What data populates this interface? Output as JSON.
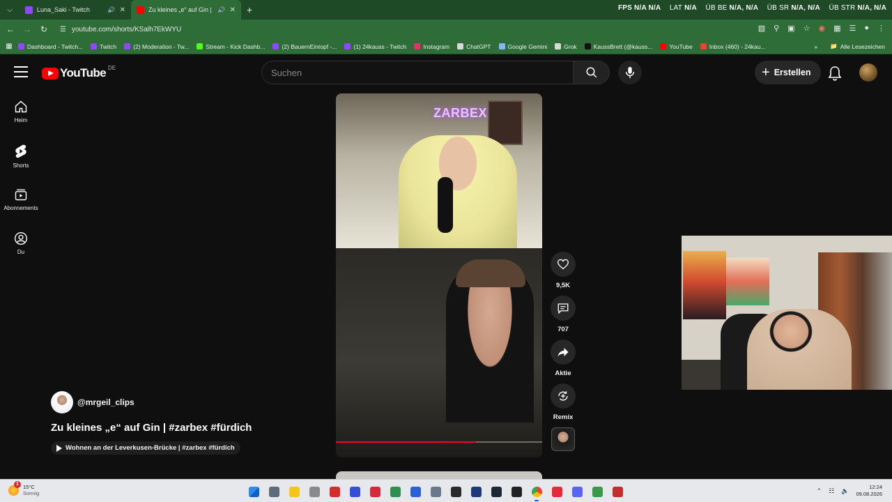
{
  "browser": {
    "tabs": [
      {
        "label": "Luna_Saki - Twitch",
        "color": "#9146ff",
        "active": false
      },
      {
        "label": "Zu kleines „e“ auf Gin | #zar",
        "color": "#ff0000",
        "active": true
      }
    ],
    "perf_overlay": {
      "fps_label": "FPS",
      "fps_value": "N/A N/A",
      "lat_label": "LAT",
      "lat_value": "N/A",
      "ube_label": "ÜB BE",
      "ube_value": "N/A, N/A",
      "usr_label": "ÜB SR",
      "usr_value": "N/A, N/A",
      "ustr_label": "ÜB STR",
      "ustr_value": "N/A, N/A"
    },
    "url": "youtube.com/shorts/KSalh7EkWYU",
    "bookmarks": [
      {
        "label": "Dashboard - Twitch...",
        "color": "#9146ff"
      },
      {
        "label": "Twitch",
        "color": "#9146ff"
      },
      {
        "label": "(2) Moderation - Tw...",
        "color": "#9146ff"
      },
      {
        "label": "Stream - Kick Dashb...",
        "color": "#53fc18"
      },
      {
        "label": "(2) BauernEintopf -...",
        "color": "#9146ff"
      },
      {
        "label": "(1) 24kauss - Twitch",
        "color": "#9146ff"
      },
      {
        "label": "Instagram",
        "color": "#e1306c"
      },
      {
        "label": "ChatGPT",
        "color": "#d8d8d8"
      },
      {
        "label": "Google Gemini",
        "color": "#8ab4f8"
      },
      {
        "label": "Grok",
        "color": "#d8d8d8"
      },
      {
        "label": "KaussBrett (@kauss...",
        "color": "#111111"
      },
      {
        "label": "YouTube",
        "color": "#ff0000"
      },
      {
        "label": "Inbox (460) - 24kau...",
        "color": "#ea4335"
      }
    ],
    "bookmarks_all": "Alle Lesezeichen"
  },
  "youtube": {
    "logo_text": "YouTube",
    "region": "DE",
    "search_placeholder": "Suchen",
    "create_label": "Erstellen",
    "sidebar": [
      {
        "label": "Heim",
        "icon": "home-icon"
      },
      {
        "label": "Shorts",
        "icon": "shorts-icon"
      },
      {
        "label": "Abonnements",
        "icon": "subscriptions-icon"
      },
      {
        "label": "Du",
        "icon": "you-icon"
      }
    ],
    "short": {
      "overlay_text": "ZARBEX",
      "channel": "@mrgeil_clips",
      "title": "Zu kleines „e“ auf Gin | #zarbex  #fürdich",
      "related": "Wohnen an der Leverkusen-Brücke | #zarbex #fürdich",
      "progress": 0.68,
      "progress_bar2": 0.69
    },
    "actions": {
      "likes": "9,5K",
      "comments": "707",
      "share": "Aktie",
      "remix": "Remix"
    }
  },
  "taskbar": {
    "weather_temp": "15°C",
    "weather_desc": "Sonnig",
    "weather_badge": "1",
    "time": "12:24",
    "date": "09.08.2026",
    "apps": [
      {
        "name": "start",
        "color": "#1e6fd9"
      },
      {
        "name": "calculator",
        "color": "#5d6b7a"
      },
      {
        "name": "file-explorer",
        "color": "#f5c518"
      },
      {
        "name": "mouse",
        "color": "#8a8a8a"
      },
      {
        "name": "opera-gx",
        "color": "#d62b2b"
      },
      {
        "name": "vivaldi",
        "color": "#3550d8"
      },
      {
        "name": "app-red",
        "color": "#d6283a"
      },
      {
        "name": "app-target",
        "color": "#2f8f4e"
      },
      {
        "name": "app-blue",
        "color": "#2a62d6"
      },
      {
        "name": "app-puzzle",
        "color": "#6a7a8a"
      },
      {
        "name": "app-dark",
        "color": "#2a2a2a"
      },
      {
        "name": "app-circle",
        "color": "#1c3a7a"
      },
      {
        "name": "steam",
        "color": "#1b2838"
      },
      {
        "name": "app-terminal",
        "color": "#222222"
      },
      {
        "name": "chrome",
        "color": "#34a853",
        "running": true
      },
      {
        "name": "opera",
        "color": "#e5283a"
      },
      {
        "name": "discord",
        "color": "#5865f2"
      },
      {
        "name": "app-layers",
        "color": "#3a9a4a"
      },
      {
        "name": "app-red2",
        "color": "#c72c2c"
      }
    ]
  }
}
